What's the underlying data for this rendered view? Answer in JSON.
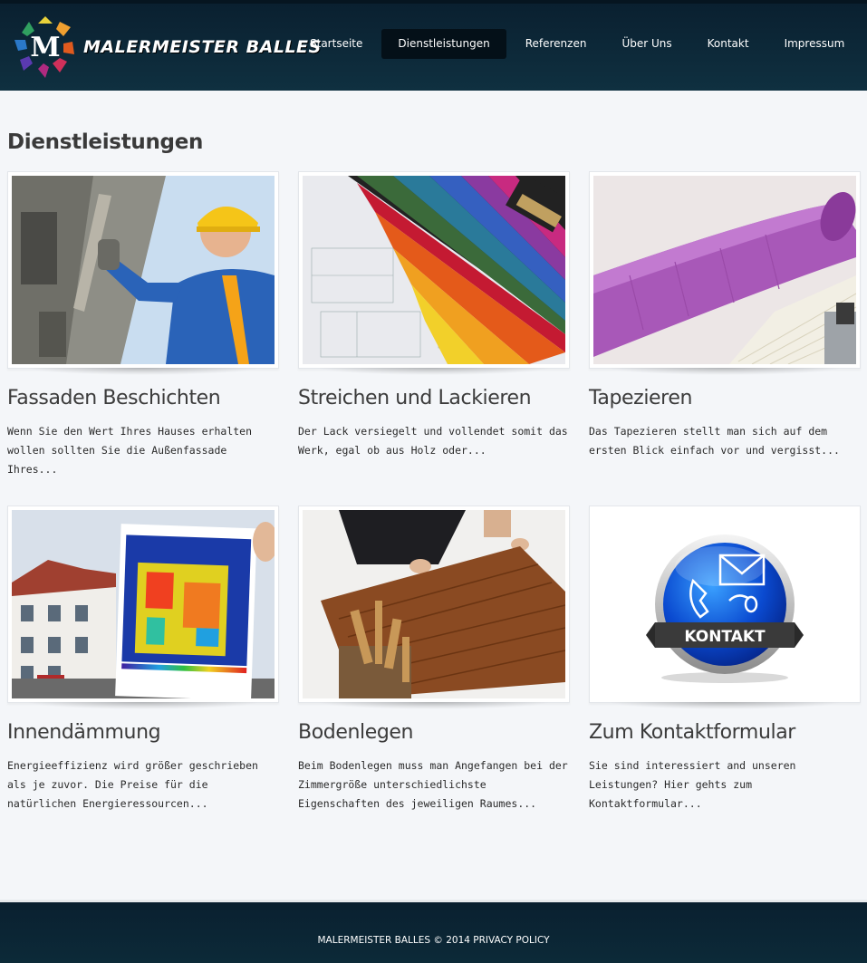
{
  "brand": {
    "name": "MALERMEISTER BALLES",
    "logo_letter": "M"
  },
  "nav": {
    "items": [
      {
        "label": "Startseite",
        "active": false
      },
      {
        "label": "Dienstleistungen",
        "active": true
      },
      {
        "label": "Referenzen",
        "active": false
      },
      {
        "label": "Über Uns",
        "active": false
      },
      {
        "label": "Kontakt",
        "active": false
      },
      {
        "label": "Impressum",
        "active": false
      }
    ]
  },
  "page": {
    "title": "Dienstleistungen"
  },
  "services": [
    {
      "title": "Fassaden Beschichten",
      "text": "Wenn Sie den Wert Ihres Hauses erhalten wollen sollten Sie die Außenfassade Ihres...",
      "image": "facade-worker"
    },
    {
      "title": "Streichen und Lackieren",
      "text": "Der Lack versiegelt und vollendet somit das Werk, egal ob aus Holz oder...",
      "image": "color-fan"
    },
    {
      "title": "Tapezieren",
      "text": "Das Tapezieren stellt man sich auf dem ersten Blick einfach vor und vergisst...",
      "image": "wallpaper-roll"
    },
    {
      "title": "Innendämmung",
      "text": "Energieeffizienz wird größer geschrieben als je zuvor. Die Preise für die natürlichen Energieressourcen...",
      "image": "thermal-image"
    },
    {
      "title": "Bodenlegen",
      "text": "Beim Bodenlegen muss man Angefangen bei der Zimmergröße unterschiedlichste Eigenschaften des jeweiligen Raumes...",
      "image": "floor-laying"
    },
    {
      "title": "Zum Kontaktformular",
      "text": "Sie sind interessiert and unseren Leistungen? Hier gehts zum Kontaktformular...",
      "image": "kontakt-button",
      "badge": "KONTAKT"
    }
  ],
  "footer": {
    "text": "MALERMEISTER BALLES © 2014 PRIVACY POLICY"
  },
  "colors": {
    "header_bg": "#0f3040",
    "nav_active": "#041018",
    "page_bg": "#f4f6f9"
  }
}
